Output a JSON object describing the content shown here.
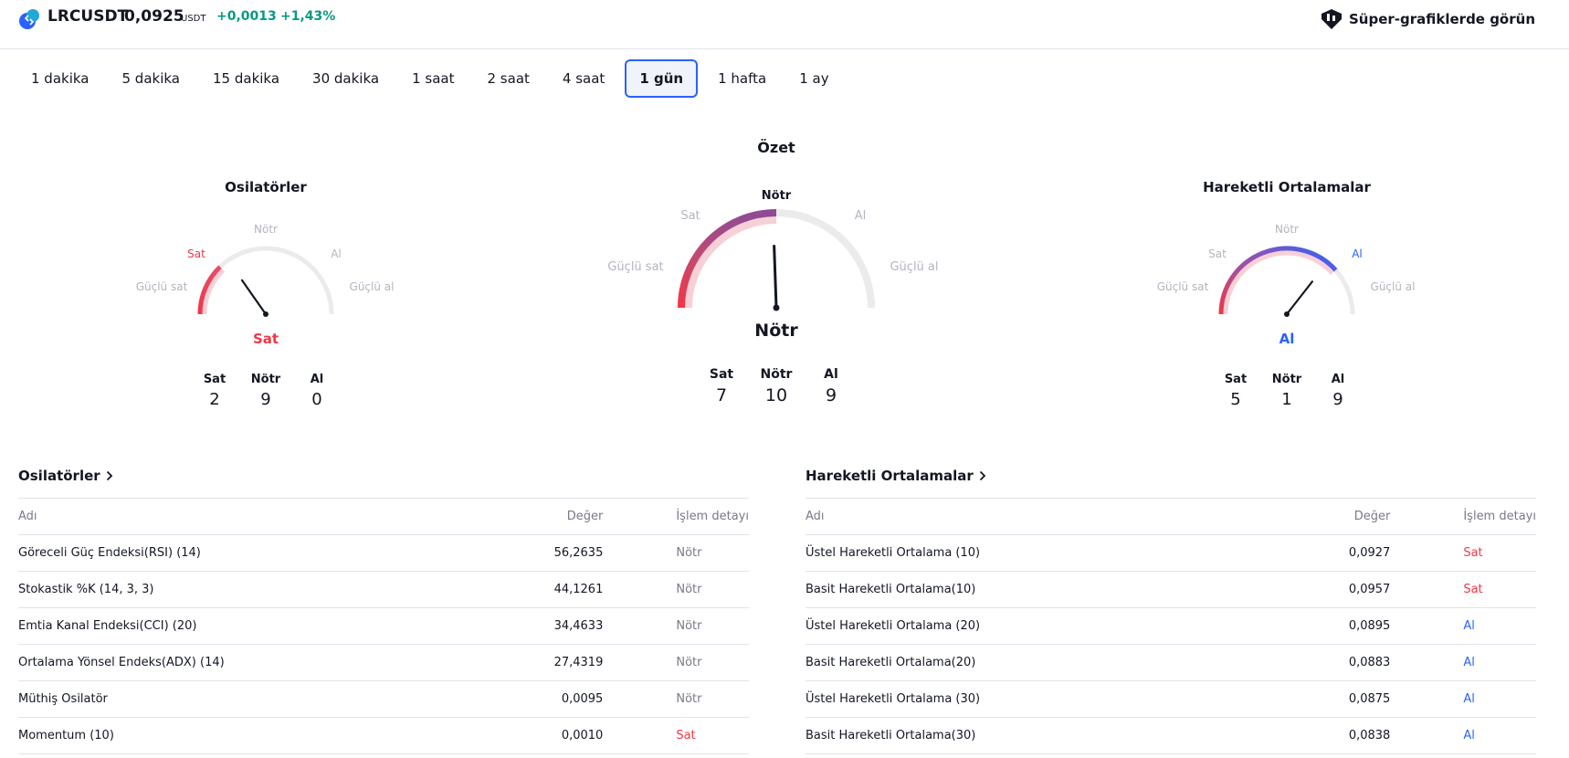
{
  "header": {
    "symbol": "LRCUSDT",
    "price": "0,0925",
    "currency": "USDT",
    "change": "+0,0013",
    "change_percent": "+1,43%",
    "supercharts_label": "Süper-grafiklerde görün",
    "supercharts_icon": "supercharts-icon",
    "logo_icon": "lrc-logo-icon",
    "colors": {
      "up": "#089981",
      "sell": "#f23645",
      "buy": "#2962ff",
      "neutral": "#b2b5be"
    }
  },
  "tabs": [
    {
      "label": "1 dakika"
    },
    {
      "label": "5 dakika"
    },
    {
      "label": "15 dakika"
    },
    {
      "label": "30 dakika"
    },
    {
      "label": "1 saat"
    },
    {
      "label": "2 saat"
    },
    {
      "label": "4 saat"
    },
    {
      "label": "1 gün",
      "active": true
    },
    {
      "label": "1 hafta"
    },
    {
      "label": "1 ay"
    }
  ],
  "gauges": {
    "oscillators": {
      "title": "Osilatörler",
      "labels": {
        "strong_sell": "Güçlü sat",
        "sell": "Sat",
        "neutral": "Nötr",
        "buy": "Al",
        "strong_buy": "Güçlü al"
      },
      "result": "Sat",
      "result_color": "#f23645",
      "counts": {
        "sell_label": "Sat",
        "neutral_label": "Nötr",
        "buy_label": "Al",
        "sell": "2",
        "neutral": "9",
        "buy": "0"
      }
    },
    "summary": {
      "title": "Özet",
      "labels": {
        "strong_sell": "Güçlü sat",
        "sell": "Sat",
        "neutral": "Nötr",
        "buy": "Al",
        "strong_buy": "Güçlü al"
      },
      "result": "Nötr",
      "result_color": "#131722",
      "counts": {
        "sell_label": "Sat",
        "neutral_label": "Nötr",
        "buy_label": "Al",
        "sell": "7",
        "neutral": "10",
        "buy": "9"
      }
    },
    "moving_averages": {
      "title": "Hareketli Ortalamalar",
      "labels": {
        "strong_sell": "Güçlü sat",
        "sell": "Sat",
        "neutral": "Nötr",
        "buy": "Al",
        "strong_buy": "Güçlü al"
      },
      "result": "Al",
      "result_color": "#2962ff",
      "counts": {
        "sell_label": "Sat",
        "neutral_label": "Nötr",
        "buy_label": "Al",
        "sell": "5",
        "neutral": "1",
        "buy": "9"
      }
    }
  },
  "oscillators_table": {
    "title": "Osilatörler",
    "headers": {
      "name": "Adı",
      "value": "Değer",
      "action": "İşlem detayı"
    },
    "rows": [
      {
        "name": "Göreceli Güç Endeksi(RSI) (14)",
        "value": "56,2635",
        "action": "Nötr",
        "color": "#787b86"
      },
      {
        "name": "Stokastik %K (14, 3, 3)",
        "value": "44,1261",
        "action": "Nötr",
        "color": "#787b86"
      },
      {
        "name": "Emtia Kanal Endeksi(CCI) (20)",
        "value": "34,4633",
        "action": "Nötr",
        "color": "#787b86"
      },
      {
        "name": "Ortalama Yönsel Endeks(ADX) (14)",
        "value": "27,4319",
        "action": "Nötr",
        "color": "#787b86"
      },
      {
        "name": "Müthiş Osilatör",
        "value": "0,0095",
        "action": "Nötr",
        "color": "#787b86"
      },
      {
        "name": "Momentum (10)",
        "value": "0,0010",
        "action": "Sat",
        "color": "#f23645"
      }
    ]
  },
  "ma_table": {
    "title": "Hareketli Ortalamalar",
    "headers": {
      "name": "Adı",
      "value": "Değer",
      "action": "İşlem detayı"
    },
    "rows": [
      {
        "name": "Üstel Hareketli Ortalama (10)",
        "value": "0,0927",
        "action": "Sat",
        "color": "#f23645"
      },
      {
        "name": "Basit Hareketli Ortalama(10)",
        "value": "0,0957",
        "action": "Sat",
        "color": "#f23645"
      },
      {
        "name": "Üstel Hareketli Ortalama (20)",
        "value": "0,0895",
        "action": "Al",
        "color": "#2962ff"
      },
      {
        "name": "Basit Hareketli Ortalama(20)",
        "value": "0,0883",
        "action": "Al",
        "color": "#2962ff"
      },
      {
        "name": "Üstel Hareketli Ortalama (30)",
        "value": "0,0875",
        "action": "Al",
        "color": "#2962ff"
      },
      {
        "name": "Basit Hareketli Ortalama(30)",
        "value": "0,0838",
        "action": "Al",
        "color": "#2962ff"
      }
    ]
  }
}
